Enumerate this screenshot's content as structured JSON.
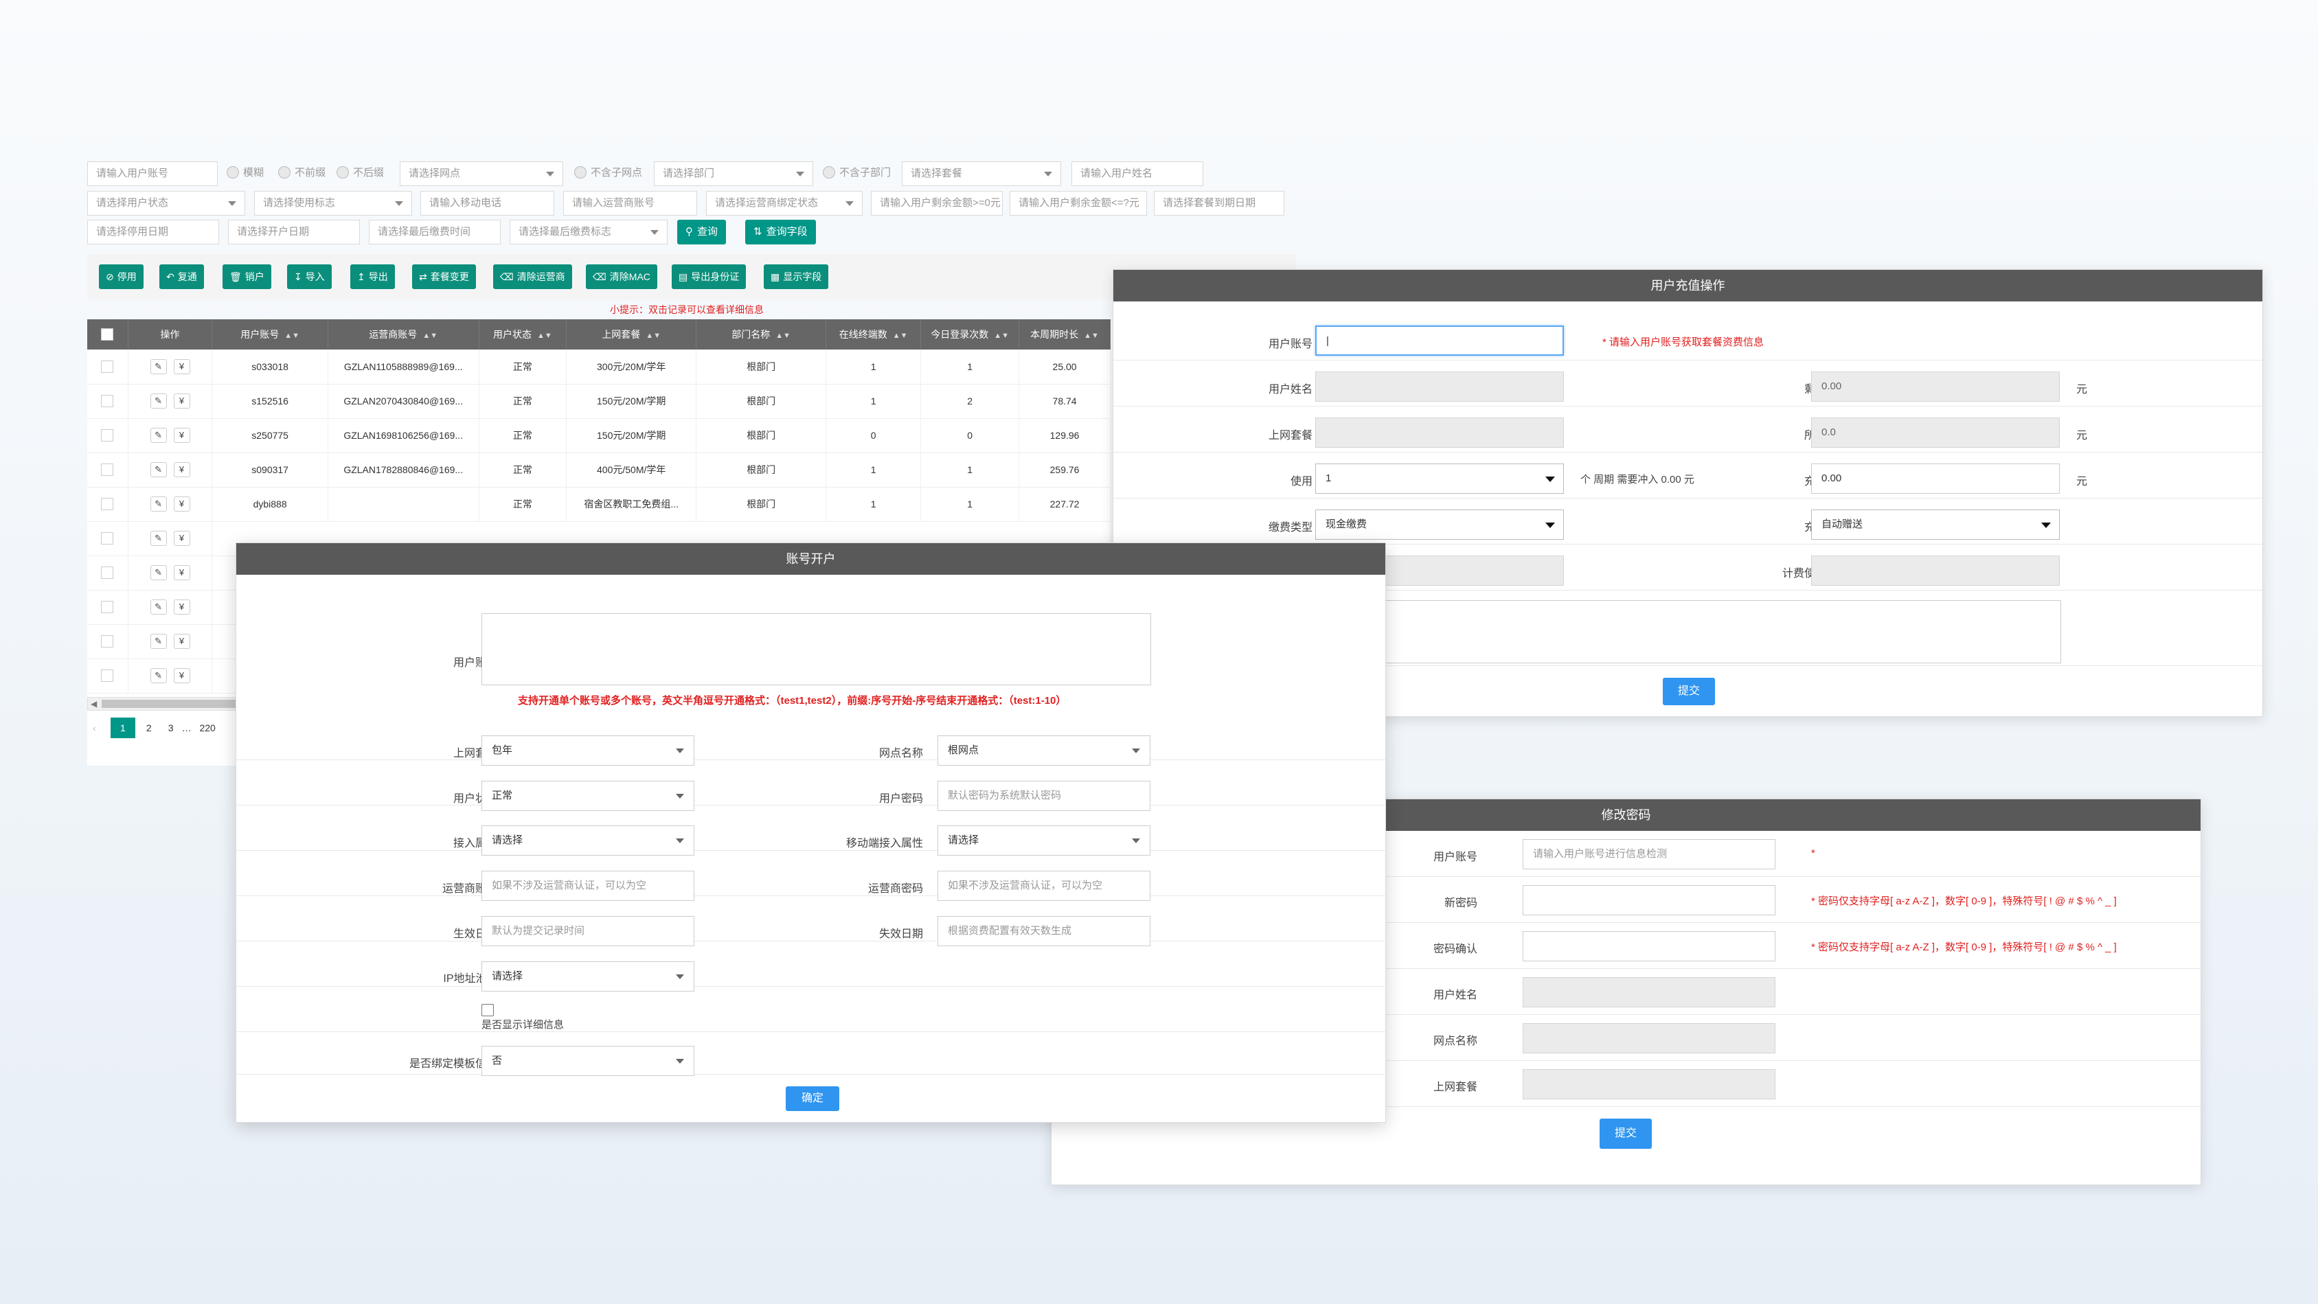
{
  "filters": {
    "row1": {
      "user_account": "请输入用户账号",
      "radio_fuzzy": "模糊",
      "radio_not_precede": "不前缀",
      "radio_not_suffix": "不后缀",
      "site": "请选择网点",
      "radio_no_sub_site": "不含子网点",
      "dept": "请选择部门",
      "radio_no_sub_dept": "不含子部门",
      "package": "请选择套餐",
      "user_name": "请输入用户姓名"
    },
    "row2": {
      "user_status": "请选择用户状态",
      "usage_flag": "请选择使用标志",
      "mobile": "请输入移动电话",
      "isp_account": "请输入运营商账号",
      "isp_bind_status": "请选择运营商绑定状态",
      "balance_gte": "请输入用户剩余金额>=0元",
      "balance_lte": "请输入用户剩余金额<=?元",
      "pkg_expire": "请选择套餐到期日期"
    },
    "row3": {
      "stop_date": "请选择停用日期",
      "open_date": "请选择开户日期",
      "last_pay_time": "请选择最后缴费时间",
      "last_pay_flag": "请选择最后缴费标志",
      "query": "查询",
      "query_fields": "查询字段"
    }
  },
  "toolbar": {
    "disable": "停用",
    "restore": "复通",
    "cancel": "销户",
    "import": "导入",
    "export": "导出",
    "pkg_change": "套餐变更",
    "clear_isp": "清除运营商",
    "clear_mac": "清除MAC",
    "export_id": "导出身份证",
    "show_fields": "显示字段"
  },
  "tip": "小提示：双击记录可以查看详细信息",
  "table": {
    "headers": [
      "操作",
      "用户账号",
      "运营商账号",
      "用户状态",
      "上网套餐",
      "部门名称",
      "在线终端数",
      "今日登录次数",
      "本周期时长"
    ],
    "rows": [
      [
        "s033018",
        "GZLAN1105888989@169...",
        "正常",
        "300元/20M/学年",
        "根部门",
        "1",
        "1",
        "25.00"
      ],
      [
        "s152516",
        "GZLAN2070430840@169...",
        "正常",
        "150元/20M/学期",
        "根部门",
        "1",
        "2",
        "78.74"
      ],
      [
        "s250775",
        "GZLAN1698106256@169...",
        "正常",
        "150元/20M/学期",
        "根部门",
        "0",
        "0",
        "129.96"
      ],
      [
        "s090317",
        "GZLAN1782880846@169...",
        "正常",
        "400元/50M/学年",
        "根部门",
        "1",
        "1",
        "259.76"
      ],
      [
        "dybi888",
        "",
        "正常",
        "宿舍区教职工免费组...",
        "根部门",
        "1",
        "1",
        "227.72"
      ]
    ]
  },
  "pager": {
    "prev": "‹",
    "p1": "1",
    "p2": "2",
    "p3": "3",
    "ellipsis": "…",
    "last": "220"
  },
  "recharge": {
    "title": "用户充值操作",
    "user_account_label": "用户账号",
    "user_account_value": "|",
    "user_account_hint": "* 请输入用户账号获取套餐资费信息",
    "user_name_label": "用户姓名",
    "balance_label": "剩余金额",
    "balance_value": "0.00",
    "unit": "元",
    "package_label": "上网套餐",
    "pkg_balance_label": "所包金额",
    "pkg_balance_value": "0.0",
    "use_label": "使用",
    "use_value": "1",
    "period_text": "个 周期 需要冲入 0.00 元",
    "amount_label": "充入金额",
    "amount_value": "0.00",
    "fee_type_label": "缴费类型",
    "fee_type_value": "现金缴费",
    "gift_label": "充值赠送",
    "gift_value": "自动赠送",
    "billing_time_label": "计费使用时间",
    "submit": "提交"
  },
  "open_account": {
    "title": "账号开户",
    "user_account_label": "用户账号",
    "hint": "支持开通单个账号或多个账号，英文半角逗号开通格式：（test1,test2），前缀:序号开始-序号结束开通格式：（test:1-10）",
    "package_label": "上网套餐",
    "package_value": "包年",
    "site_label": "网点名称",
    "site_value": "根网点",
    "status_label": "用户状态",
    "status_value": "正常",
    "password_label": "用户密码",
    "password_placeholder": "默认密码为系统默认密码",
    "access_label": "接入属性",
    "access_value": "请选择",
    "mobile_access_label": "移动端接入属性",
    "mobile_access_value": "请选择",
    "isp_account_label": "运营商账号",
    "isp_account_placeholder": "如果不涉及运营商认证，可以为空",
    "isp_password_label": "运营商密码",
    "isp_password_placeholder": "如果不涉及运营商认证，可以为空",
    "effective_label": "生效日期",
    "effective_placeholder": "默认为提交记录时间",
    "expire_label": "失效日期",
    "expire_placeholder": "根据资费配置有效天数生成",
    "ip_pool_label": "IP地址池",
    "ip_pool_q": "?",
    "ip_pool_value": "请选择",
    "show_detail_label": "是否显示详细信息",
    "bind_template_label": "是否绑定模板信息",
    "bind_template_value": "否",
    "confirm": "确定"
  },
  "password": {
    "title": "修改密码",
    "user_account_label": "用户账号",
    "user_account_placeholder": "请输入用户账号进行信息检测",
    "star": "*",
    "new_pwd_label": "新密码",
    "rule": "* 密码仅支持字母[ a-z A-Z ]，数字[ 0-9 ]，特殊符号[ ! @ # $ % ^ _ ]",
    "confirm_pwd_label": "密码确认",
    "user_name_label": "用户姓名",
    "site_label": "网点名称",
    "package_label": "上网套餐",
    "submit": "提交"
  }
}
